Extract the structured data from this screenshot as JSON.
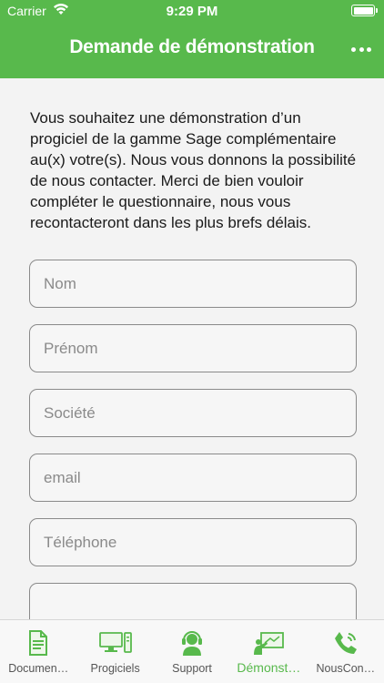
{
  "status_bar": {
    "carrier": "Carrier",
    "time": "9:29 PM"
  },
  "nav": {
    "title": "Demande de démonstration"
  },
  "intro_text": "Vous souhaitez une démonstration d’un progiciel de la gamme Sage complémentaire au(x) votre(s). Nous vous donnons la possibilité de nous contacter. Merci de bien vouloir compléter le questionnaire, nous vous recontacteront dans les plus brefs délais.",
  "form": {
    "nom_placeholder": "Nom",
    "prenom_placeholder": "Prénom",
    "societe_placeholder": "Société",
    "email_placeholder": "email",
    "telephone_placeholder": "Téléphone",
    "extra_placeholder": ""
  },
  "tabs": [
    {
      "label": "Documen…",
      "icon": "document-icon"
    },
    {
      "label": "Progiciels",
      "icon": "computer-icon"
    },
    {
      "label": "Support",
      "icon": "headset-icon"
    },
    {
      "label": "Démonst…",
      "icon": "presentation-icon",
      "active": true
    },
    {
      "label": "NousCon…",
      "icon": "phone-icon"
    }
  ],
  "colors": {
    "accent": "#58b94c",
    "background": "#f3f3f3"
  }
}
